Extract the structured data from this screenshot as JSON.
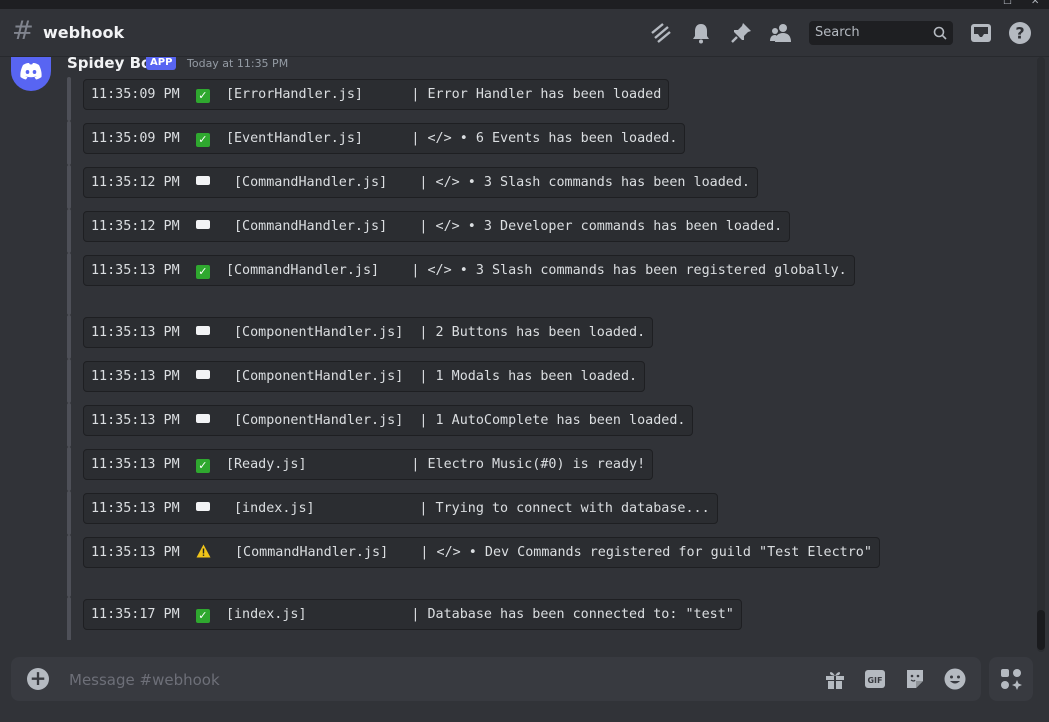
{
  "header": {
    "channel": "webhook",
    "search_placeholder": "Search"
  },
  "message": {
    "author": "Spidey Bot",
    "badge": "APP",
    "timestamp": "Today at 11:35 PM"
  },
  "logs": [
    {
      "emoji": "check",
      "time": "11:35:09 PM",
      "text": "[ErrorHandler.js]      | Error Handler has been loaded"
    },
    {
      "emoji": "check",
      "time": "11:35:09 PM",
      "text": "[EventHandler.js]      | </> • 6 Events has been loaded."
    },
    {
      "emoji": "dot",
      "time": "11:35:12 PM",
      "text": " [CommandHandler.js]    | </> • 3 Slash commands has been loaded."
    },
    {
      "emoji": "dot",
      "time": "11:35:12 PM",
      "text": " [CommandHandler.js]    | </> • 3 Developer commands has been loaded."
    },
    {
      "emoji": "check",
      "time": "11:35:13 PM",
      "text": "[CommandHandler.js]    | </> • 3 Slash commands has been registered globally."
    },
    {
      "emoji": "dot",
      "time": "11:35:13 PM",
      "text": " [ComponentHandler.js]  | 2 Buttons has been loaded."
    },
    {
      "emoji": "dot",
      "time": "11:35:13 PM",
      "text": " [ComponentHandler.js]  | 1 Modals has been loaded."
    },
    {
      "emoji": "dot",
      "time": "11:35:13 PM",
      "text": " [ComponentHandler.js]  | 1 AutoComplete has been loaded."
    },
    {
      "emoji": "check",
      "time": "11:35:13 PM",
      "text": "[Ready.js]             | Electro Music(#0) is ready!"
    },
    {
      "emoji": "dot",
      "time": "11:35:13 PM",
      "text": " [index.js]             | Trying to connect with database..."
    },
    {
      "emoji": "warn",
      "time": "11:35:13 PM",
      "text": " [CommandHandler.js]    | </> • Dev Commands registered for guild \"Test Electro\""
    },
    {
      "emoji": "check",
      "time": "11:35:17 PM",
      "text": "[index.js]             | Database has been connected to: \"test\""
    }
  ],
  "composer": {
    "placeholder": "Message #webhook"
  },
  "icons": {
    "threads": "threads-icon",
    "notifications": "bell-icon",
    "pins": "pin-icon",
    "members": "members-icon",
    "inbox": "inbox-icon",
    "help": "help-icon",
    "gift": "gift-icon",
    "gif": "gif-icon",
    "sticker": "sticker-icon",
    "emoji": "emoji-icon",
    "apps": "apps-icon"
  },
  "colors": {
    "blurple": "#5865f2",
    "background": "#313338",
    "check": "#2fa82f"
  }
}
